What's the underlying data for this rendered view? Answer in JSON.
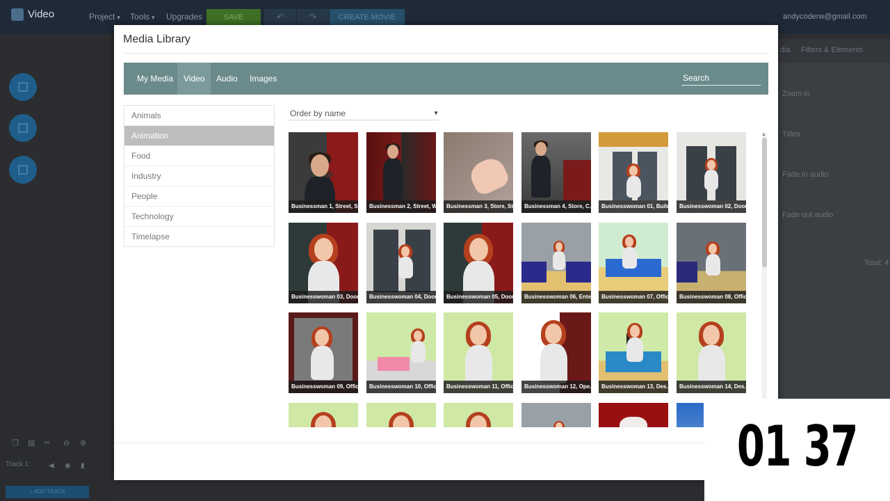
{
  "app": {
    "brand": "Video",
    "menu": [
      "Project",
      "Tools",
      "Upgrades"
    ],
    "save_label": "SAVE",
    "create_label": "CREATE MOVIE",
    "user_email": "andycoderw@gmail.com"
  },
  "right_panel": {
    "tabs": [
      "dia",
      "Filters & Elements"
    ],
    "items": [
      "Zoom in",
      "Titles",
      "Fade in audio",
      "Fade out audio"
    ],
    "total": "Total: 4"
  },
  "timeline": {
    "track_label": "Track 1",
    "add_track": "+ ADD TRACK"
  },
  "modal": {
    "title": "Media Library",
    "tabs": [
      {
        "label": "My Media",
        "active": false
      },
      {
        "label": "Video",
        "active": true
      },
      {
        "label": "Audio",
        "active": false
      },
      {
        "label": "Images",
        "active": false
      }
    ],
    "search_placeholder": "Search",
    "categories": [
      {
        "label": "Animals",
        "active": false
      },
      {
        "label": "Animation",
        "active": true
      },
      {
        "label": "Food",
        "active": false
      },
      {
        "label": "Industry",
        "active": false
      },
      {
        "label": "People",
        "active": false
      },
      {
        "label": "Technology",
        "active": false
      },
      {
        "label": "Timelapse",
        "active": false
      }
    ],
    "order_select": "Order by name",
    "videos": [
      {
        "caption": "Businessman 1, Street, St...",
        "theme": "man-street"
      },
      {
        "caption": "Businessman 2, Street, W...",
        "theme": "man-street-full"
      },
      {
        "caption": "Businessman 3, Store, St...",
        "theme": "hand"
      },
      {
        "caption": "Businessman 4, Store, C...",
        "theme": "man-store"
      },
      {
        "caption": "Businesswoman 01, Buildi...",
        "theme": "woman-door"
      },
      {
        "caption": "Businesswoman 02, Door...",
        "theme": "woman-door-white"
      },
      {
        "caption": "Businesswoman 03, Door...",
        "theme": "woman-dark"
      },
      {
        "caption": "Businesswoman 04, Door...",
        "theme": "woman-door-far"
      },
      {
        "caption": "Businesswoman 05, Door...",
        "theme": "woman-dark"
      },
      {
        "caption": "Businesswoman 06, Ente...",
        "theme": "woman-room-blue"
      },
      {
        "caption": "Businesswoman 07, Offic...",
        "theme": "woman-office-blue"
      },
      {
        "caption": "Businesswoman 08, Offic...",
        "theme": "woman-room-dark"
      },
      {
        "caption": "Businesswoman 09, Offic...",
        "theme": "woman-frame"
      },
      {
        "caption": "Businesswoman 10, Offic...",
        "theme": "woman-green-desk"
      },
      {
        "caption": "Businesswoman 11, Offic...",
        "theme": "woman-green"
      },
      {
        "caption": "Businesswoman 12, Ope...",
        "theme": "woman-door-red"
      },
      {
        "caption": "Businesswoman 13, Des...",
        "theme": "woman-desk-green"
      },
      {
        "caption": "Businesswoman 14, Des...",
        "theme": "woman-green"
      },
      {
        "caption": "",
        "theme": "woman-green"
      },
      {
        "caption": "",
        "theme": "woman-green"
      },
      {
        "caption": "",
        "theme": "woman-green"
      },
      {
        "caption": "",
        "theme": "woman-room-blue"
      },
      {
        "caption": "",
        "theme": "cat-red"
      },
      {
        "caption": "",
        "theme": "sky"
      }
    ]
  },
  "timer": "01 37",
  "colors": {
    "navbar": "#6b8a8c",
    "navbar_active": "#7c9a9c",
    "category_active": "#bdbdbd",
    "save_green": "#3f6f24"
  }
}
